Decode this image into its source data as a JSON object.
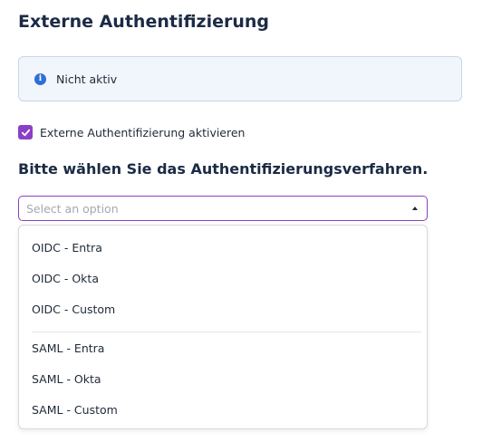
{
  "page": {
    "title": "Externe Authentifizierung"
  },
  "status": {
    "icon": "info-icon",
    "text": "Nicht aktiv",
    "accent": "#2f6fd6"
  },
  "toggle": {
    "checked": true,
    "label": "Externe Authentifizierung aktivieren",
    "accent": "#8b3fc7"
  },
  "method": {
    "heading": "Bitte wählen Sie das Authentifizierungsverfahren.",
    "placeholder": "Select an option",
    "groups": [
      {
        "options": [
          "OIDC - Entra",
          "OIDC - Okta",
          "OIDC - Custom"
        ]
      },
      {
        "options": [
          "SAML - Entra",
          "SAML - Okta",
          "SAML - Custom"
        ]
      }
    ]
  }
}
